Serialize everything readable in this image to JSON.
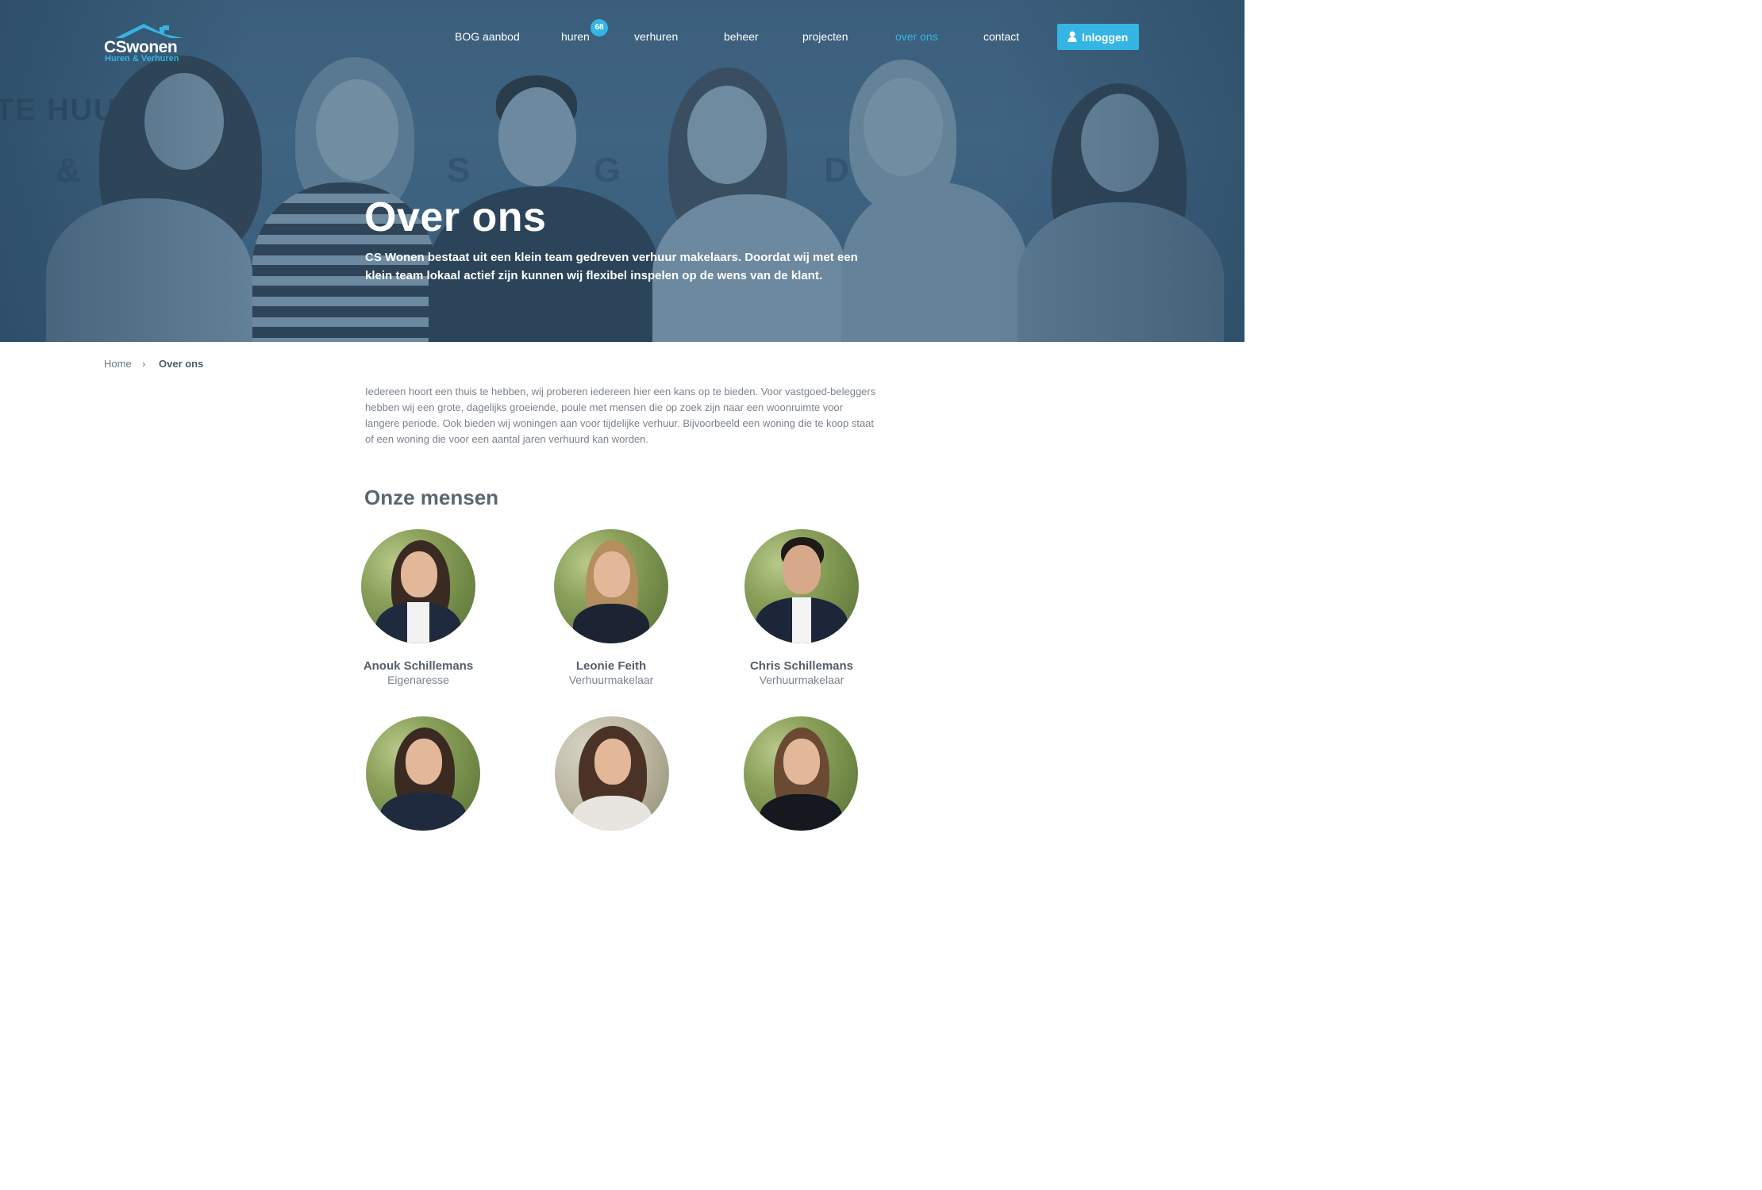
{
  "header": {
    "brand": "CSwonen",
    "tagline": "Huren & Verhuren",
    "nav": [
      {
        "label": "BOG aanbod",
        "active": false
      },
      {
        "label": "huren",
        "active": false,
        "badge": "68"
      },
      {
        "label": "verhuren",
        "active": false
      },
      {
        "label": "beheer",
        "active": false
      },
      {
        "label": "projecten",
        "active": false
      },
      {
        "label": "over ons",
        "active": true
      },
      {
        "label": "contact",
        "active": false
      }
    ],
    "login_label": "Inloggen"
  },
  "hero": {
    "title": "Over ons",
    "lead": "CS Wonen bestaat uit een klein team gedreven verhuur makelaars. Doordat wij met een klein team lokaal actief zijn kunnen wij flexibel inspelen op de wens van de klant."
  },
  "breadcrumb": {
    "home": "Home",
    "separator": "›",
    "current": "Over ons"
  },
  "intro": "Iedereen hoort een thuis te hebben, wij proberen iedereen hier een kans op te bieden. Voor vastgoed-beleggers hebben wij een grote, dagelijks groeiende, poule met mensen die op zoek zijn naar een woonruimte voor langere periode. Ook bieden wij woningen aan voor tijdelijke verhuur. Bijvoorbeeld een woning die te koop staat of een woning die voor een aantal jaren verhuurd kan worden.",
  "team": {
    "title": "Onze mensen",
    "members": [
      {
        "name": "Anouk Schillemans",
        "role": "Eigenaresse"
      },
      {
        "name": "Leonie Feith",
        "role": "Verhuurmakelaar"
      },
      {
        "name": "Chris Schillemans",
        "role": "Verhuurmakelaar"
      },
      {
        "name": "",
        "role": ""
      },
      {
        "name": "",
        "role": ""
      },
      {
        "name": "",
        "role": ""
      }
    ]
  },
  "colors": {
    "accent": "#35b5e4",
    "hero_tint": "#3f6280",
    "text": "#5d6670"
  }
}
